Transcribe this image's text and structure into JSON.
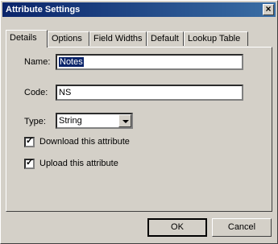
{
  "window": {
    "title": "Attribute Settings"
  },
  "tabs": [
    "Details",
    "Options",
    "Field Widths",
    "Default",
    "Lookup Table"
  ],
  "form": {
    "name_label": "Name:",
    "name_value": "Notes",
    "code_label": "Code:",
    "code_value": "NS",
    "type_label": "Type:",
    "type_value": "String",
    "download_label": "Download this attribute",
    "download_checked": true,
    "upload_label": "Upload this attribute",
    "upload_checked": true
  },
  "buttons": {
    "ok": "OK",
    "cancel": "Cancel"
  }
}
